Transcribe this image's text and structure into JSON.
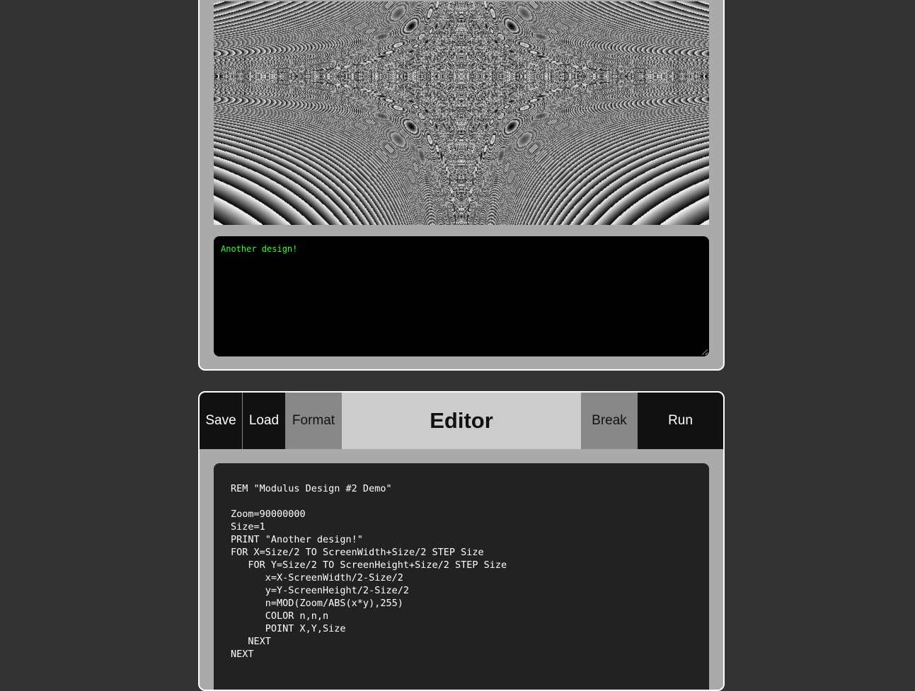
{
  "output": {
    "console_text": "Another design!"
  },
  "toolbar": {
    "save_label": "Save",
    "load_label": "Load",
    "format_label": "Format",
    "title": "Editor",
    "break_label": "Break",
    "run_label": "Run"
  },
  "editor": {
    "lines": [
      "REM \"Modulus Design #2 Demo\"",
      "",
      "Zoom=90000000",
      "Size=1",
      "PRINT \"Another design!\"",
      "FOR X=Size/2 TO ScreenWidth+Size/2 STEP Size",
      "   FOR Y=Size/2 TO ScreenHeight+Size/2 STEP Size",
      "      x=X-ScreenWidth/2-Size/2",
      "      y=Y-ScreenHeight/2-Size/2",
      "      n=MOD(Zoom/ABS(x*y),255)",
      "      COLOR n,n,n",
      "      POINT X,Y,Size",
      "   NEXT",
      "NEXT"
    ]
  },
  "colors": {
    "page_background": "#333333",
    "panel_background": "#aaaaaa",
    "console_text": "#33ff33",
    "code_background": "#222222"
  }
}
